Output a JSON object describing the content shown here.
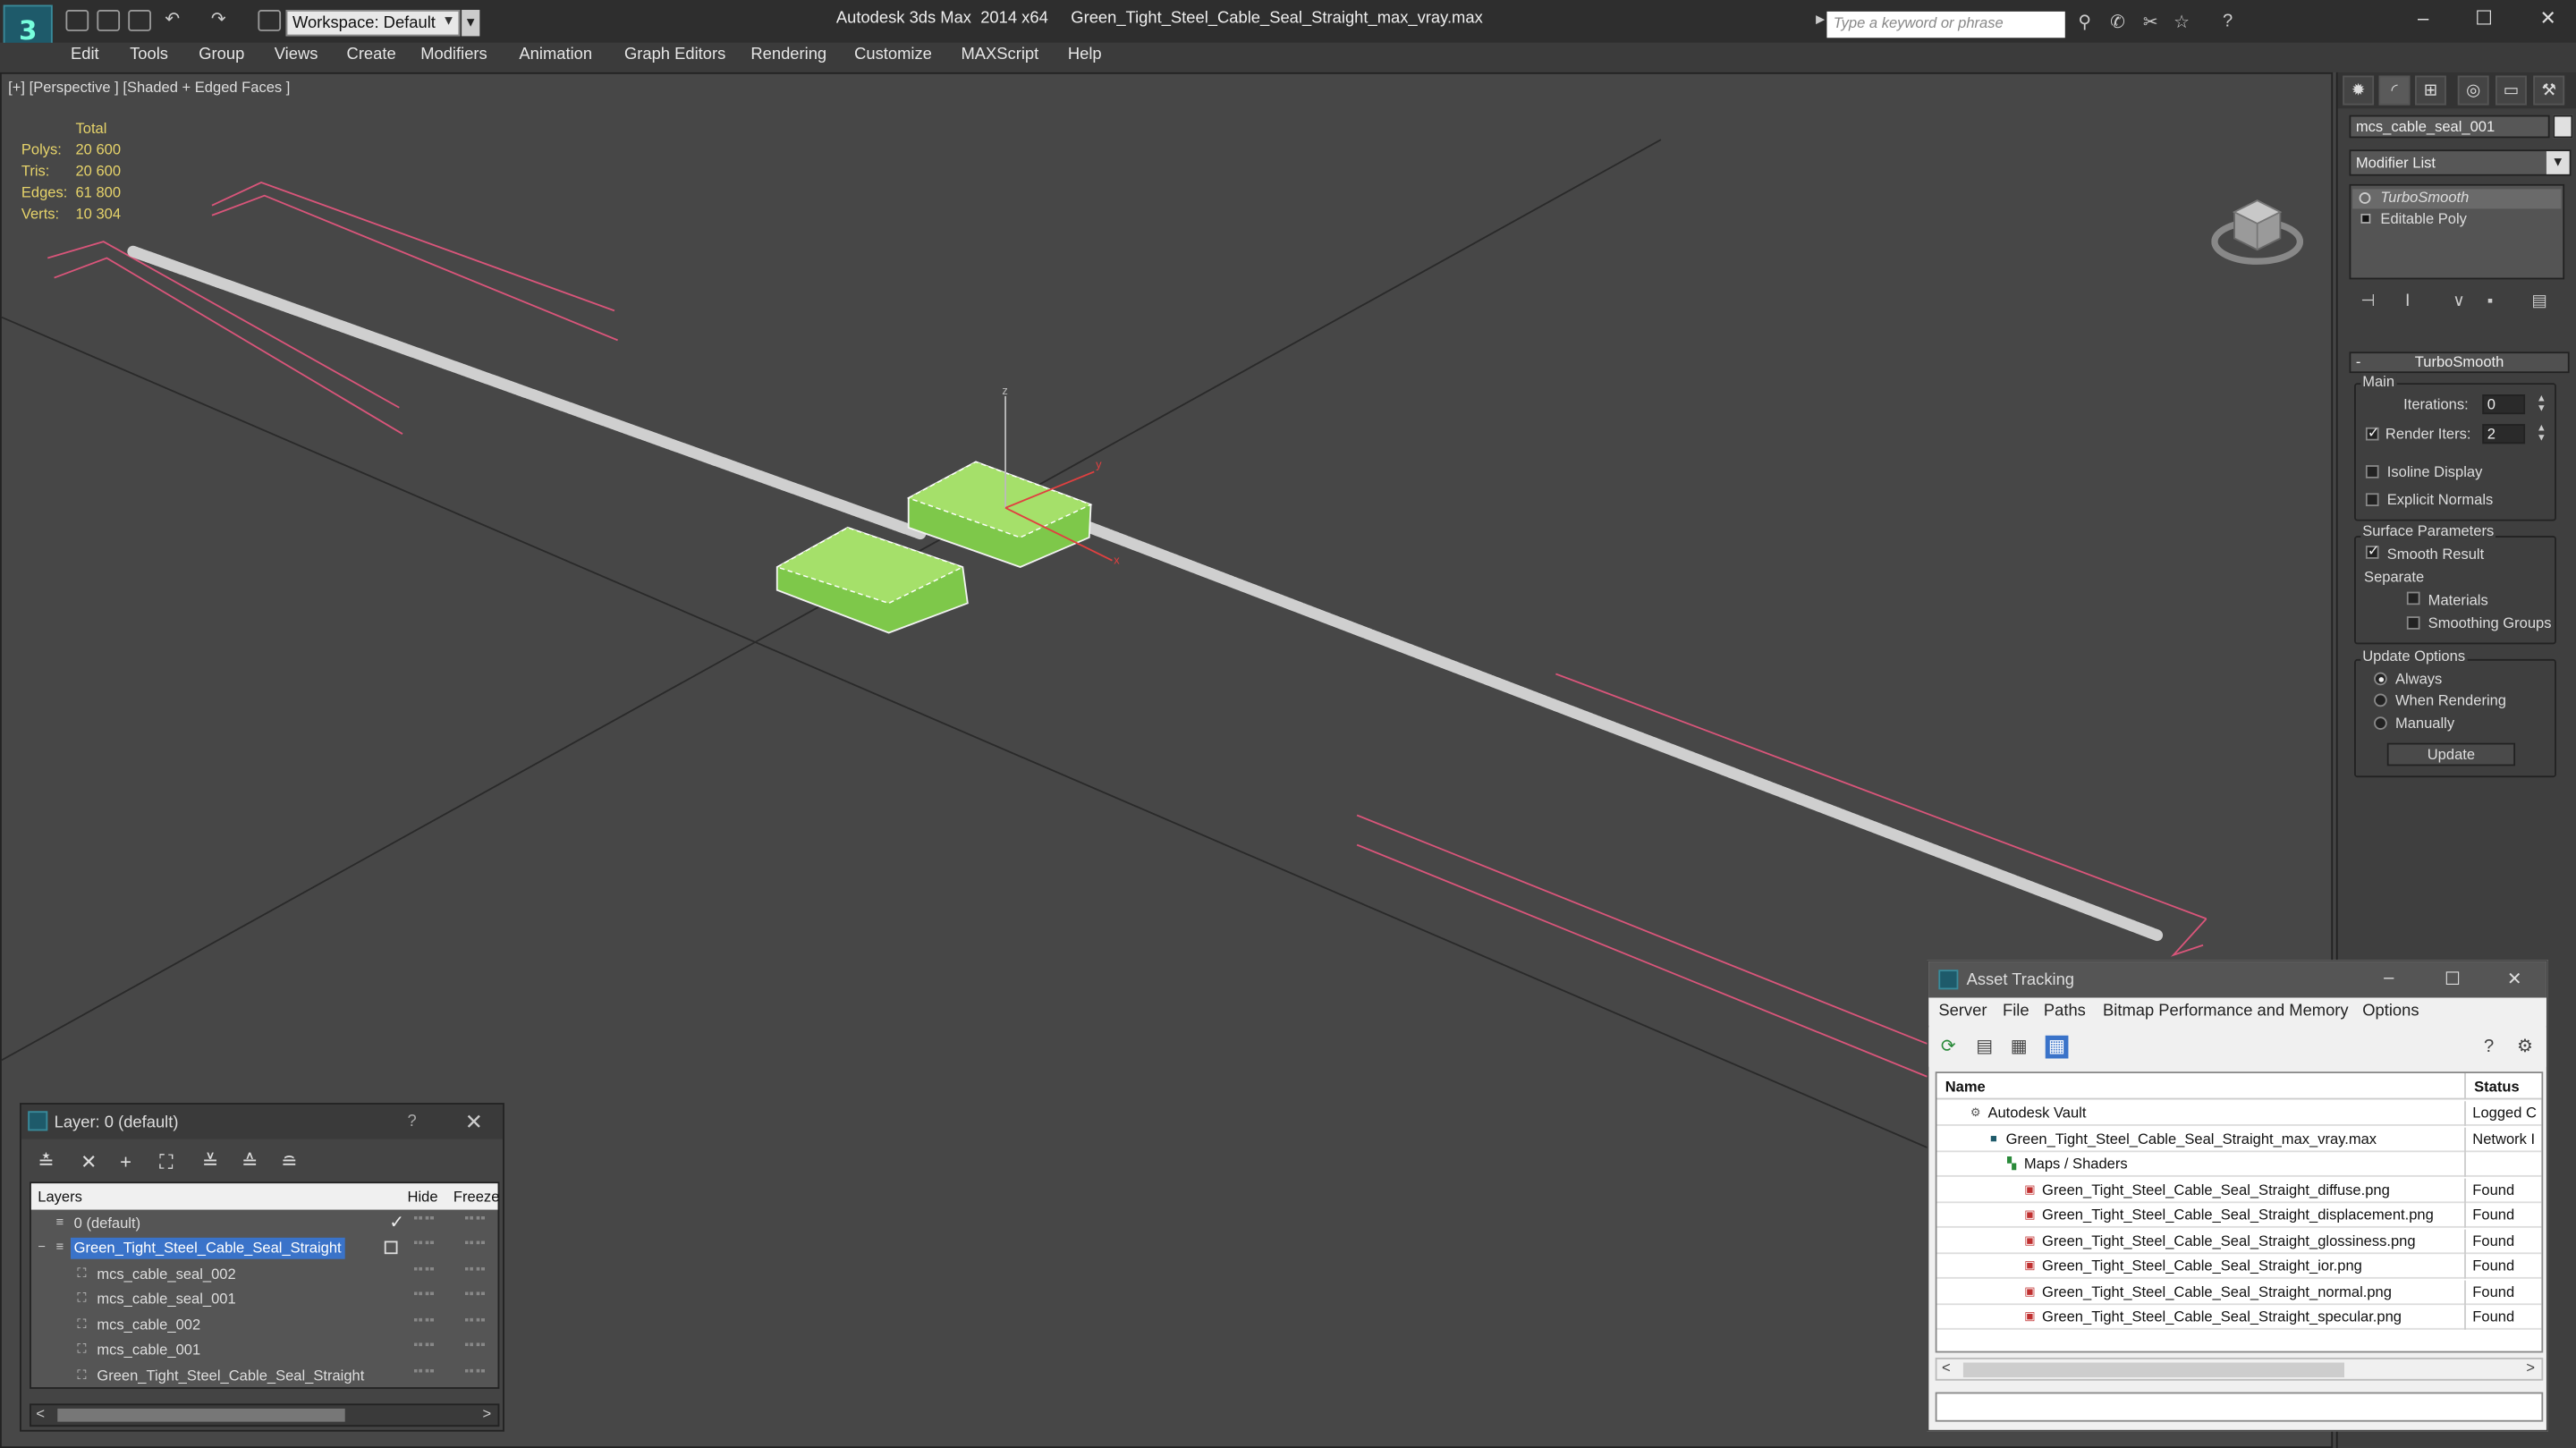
{
  "app": {
    "title": "Autodesk 3ds Max  2014 x64     Green_Tight_Steel_Cable_Seal_Straight_max_vray.max",
    "workspace": "Workspace: Default",
    "search_placeholder": "Type a keyword or phrase"
  },
  "menu": [
    "Edit",
    "Tools",
    "Group",
    "Views",
    "Create",
    "Modifiers",
    "Animation",
    "Graph Editors",
    "Rendering",
    "Customize",
    "MAXScript",
    "Help"
  ],
  "viewport": {
    "label": "[+] [Perspective ] [Shaded + Edged Faces ]",
    "stats": {
      "header": "Total",
      "rows": [
        {
          "key": "Polys:",
          "value": "20 600"
        },
        {
          "key": "Tris:",
          "value": "20 600"
        },
        {
          "key": "Edges:",
          "value": "61 800"
        },
        {
          "key": "Verts:",
          "value": "10 304"
        }
      ]
    },
    "axis_labels": {
      "z": "z",
      "y": "y",
      "x": "x"
    },
    "colors": {
      "background": "#474747",
      "grid": "#2a2a2a",
      "wire": "#cfcfcf",
      "selected": "#7ec84a",
      "guides": "#d9557a"
    }
  },
  "command_panel": {
    "object_name": "mcs_cable_seal_001",
    "modifier_list": "Modifier List",
    "stack": [
      "TurboSmooth",
      "Editable Poly"
    ],
    "rollout_title": "TurboSmooth",
    "main": {
      "label": "Main",
      "iterations_label": "Iterations:",
      "iterations_value": "0",
      "render_iters_label": "Render Iters:",
      "render_iters_value": "2",
      "render_iters_checked": true,
      "isoline_display": "Isoline Display",
      "explicit_normals": "Explicit Normals"
    },
    "surface": {
      "label": "Surface Parameters",
      "smooth_result": "Smooth Result",
      "separate": "Separate",
      "materials": "Materials",
      "smoothing_groups": "Smoothing Groups"
    },
    "update": {
      "label": "Update Options",
      "always": "Always",
      "when_rendering": "When Rendering",
      "manually": "Manually",
      "button": "Update",
      "selected": "Always"
    }
  },
  "layer_window": {
    "title": "Layer: 0 (default)",
    "help": "?",
    "columns": [
      "Layers",
      "Hide",
      "Freeze"
    ],
    "rows": [
      {
        "name": "0 (default)",
        "level": 0,
        "selected": false
      },
      {
        "name": "Green_Tight_Steel_Cable_Seal_Straight",
        "level": 0,
        "selected": true
      },
      {
        "name": "mcs_cable_seal_002",
        "level": 1,
        "selected": false
      },
      {
        "name": "mcs_cable_seal_001",
        "level": 1,
        "selected": false
      },
      {
        "name": "mcs_cable_002",
        "level": 1,
        "selected": false
      },
      {
        "name": "mcs_cable_001",
        "level": 1,
        "selected": false
      },
      {
        "name": "Green_Tight_Steel_Cable_Seal_Straight",
        "level": 1,
        "selected": false
      }
    ]
  },
  "asset_tracking": {
    "title": "Asset Tracking",
    "menu": [
      "Server",
      "File",
      "Paths",
      "Bitmap Performance and Memory",
      "Options"
    ],
    "columns": [
      "Name",
      "Status"
    ],
    "rows": [
      {
        "name": "Autodesk Vault",
        "status": "Logged C",
        "indent": 1,
        "icon": "vault"
      },
      {
        "name": "Green_Tight_Steel_Cable_Seal_Straight_max_vray.max",
        "status": "Network I",
        "indent": 2,
        "icon": "max"
      },
      {
        "name": "Maps / Shaders",
        "status": "",
        "indent": 3,
        "icon": "maps"
      },
      {
        "name": "Green_Tight_Steel_Cable_Seal_Straight_diffuse.png",
        "status": "Found",
        "indent": 4,
        "icon": "png"
      },
      {
        "name": "Green_Tight_Steel_Cable_Seal_Straight_displacement.png",
        "status": "Found",
        "indent": 4,
        "icon": "png"
      },
      {
        "name": "Green_Tight_Steel_Cable_Seal_Straight_glossiness.png",
        "status": "Found",
        "indent": 4,
        "icon": "png"
      },
      {
        "name": "Green_Tight_Steel_Cable_Seal_Straight_ior.png",
        "status": "Found",
        "indent": 4,
        "icon": "png"
      },
      {
        "name": "Green_Tight_Steel_Cable_Seal_Straight_normal.png",
        "status": "Found",
        "indent": 4,
        "icon": "png"
      },
      {
        "name": "Green_Tight_Steel_Cable_Seal_Straight_specular.png",
        "status": "Found",
        "indent": 4,
        "icon": "png"
      }
    ]
  }
}
